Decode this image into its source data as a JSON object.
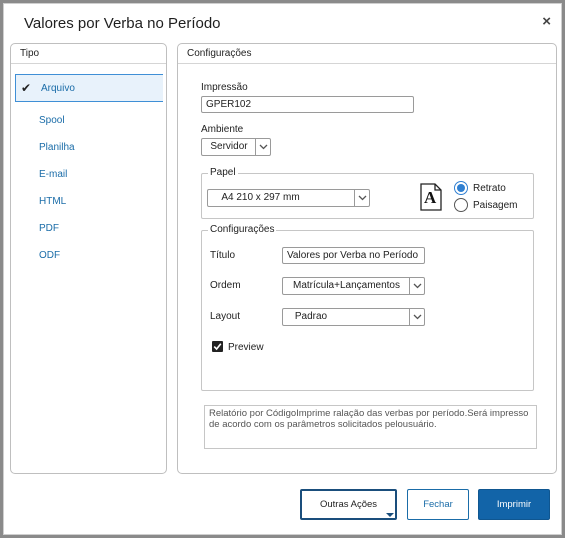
{
  "dialog": {
    "title": "Valores por Verba no Período",
    "close_label": "×"
  },
  "tipo": {
    "header": "Tipo",
    "selected": "Arquivo",
    "items": [
      "Spool",
      "Planilha",
      "E-mail",
      "HTML",
      "PDF",
      "ODF"
    ]
  },
  "configuracoes": {
    "header": "Configurações",
    "impressao_label": "Impressão",
    "impressao_value": "GPER102",
    "ambiente_label": "Ambiente",
    "ambiente_value": "Servidor",
    "papel": {
      "legend": "Papel",
      "size_value": "A4 210 x 297 mm",
      "orientation_glyph": "A",
      "retrato_label": "Retrato",
      "paisagem_label": "Paisagem",
      "selected_orientation": "Retrato"
    },
    "inner": {
      "legend": "Configurações",
      "titulo_label": "Título",
      "titulo_value": "Valores por Verba no Período",
      "ordem_label": "Ordem",
      "ordem_value": "Matrícula+Lançamentos",
      "layout_label": "Layout",
      "layout_value": "Padrao",
      "preview_label": "Preview",
      "preview_checked": true
    },
    "description": "Relatório por CódigoImprime ralação das verbas por período.Será impresso de acordo com os parâmetros solicitados pelousuário."
  },
  "buttons": {
    "outras_acoes": "Outras Ações",
    "fechar": "Fechar",
    "imprimir": "Imprimir"
  },
  "colors": {
    "accent": "#1264a8",
    "link": "#1a6ca8",
    "radio_selected": "#2f7fd1"
  }
}
